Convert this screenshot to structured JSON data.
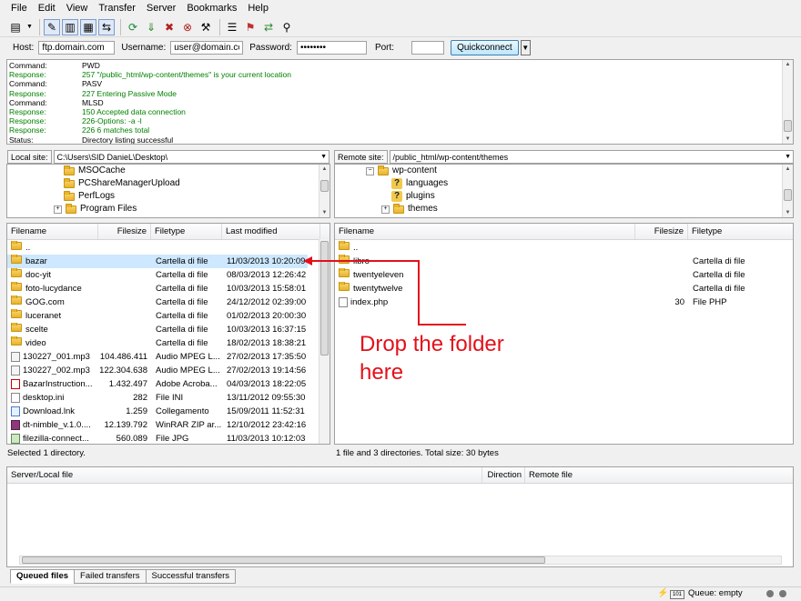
{
  "menu": [
    "File",
    "Edit",
    "View",
    "Transfer",
    "Server",
    "Bookmarks",
    "Help"
  ],
  "quickconnect": {
    "host_label": "Host:",
    "host_value": "ftp.domain.com",
    "username_label": "Username:",
    "username_value": "user@domain.com",
    "password_label": "Password:",
    "password_value": "••••••••",
    "port_label": "Port:",
    "port_value": "",
    "button_label": "Quickconnect"
  },
  "log": [
    {
      "k": "Command:",
      "v": "PWD",
      "type": "cmd"
    },
    {
      "k": "Response:",
      "v": "257 \"/public_html/wp-content/themes\" is your current location",
      "type": "resp"
    },
    {
      "k": "Command:",
      "v": "PASV",
      "type": "cmd"
    },
    {
      "k": "Response:",
      "v": "227 Entering Passive Mode",
      "type": "resp"
    },
    {
      "k": "Command:",
      "v": "MLSD",
      "type": "cmd"
    },
    {
      "k": "Response:",
      "v": "150 Accepted data connection",
      "type": "resp"
    },
    {
      "k": "Response:",
      "v": "226-Options: -a -l",
      "type": "resp"
    },
    {
      "k": "Response:",
      "v": "226 6 matches total",
      "type": "resp"
    },
    {
      "k": "Status:",
      "v": "Directory listing successful",
      "type": "stat"
    }
  ],
  "local": {
    "site_label": "Local site:",
    "path": "C:\\Users\\SID DanieL\\Desktop\\",
    "tree": [
      "MSOCache",
      "PCShareManagerUpload",
      "PerfLogs",
      "Program Files"
    ],
    "columns": [
      "Filename",
      "Filesize",
      "Filetype",
      "Last modified"
    ],
    "files": [
      {
        "name": "..",
        "size": "",
        "type": "",
        "date": "",
        "icon": "folder"
      },
      {
        "name": "bazar",
        "size": "",
        "type": "Cartella di file",
        "date": "11/03/2013 10:20:09",
        "icon": "folder"
      },
      {
        "name": "doc-yit",
        "size": "",
        "type": "Cartella di file",
        "date": "08/03/2013 12:26:42",
        "icon": "folder"
      },
      {
        "name": "foto-lucydance",
        "size": "",
        "type": "Cartella di file",
        "date": "10/03/2013 15:58:01",
        "icon": "folder"
      },
      {
        "name": "GOG.com",
        "size": "",
        "type": "Cartella di file",
        "date": "24/12/2012 02:39:00",
        "icon": "folder"
      },
      {
        "name": "luceranet",
        "size": "",
        "type": "Cartella di file",
        "date": "01/02/2013 20:00:30",
        "icon": "folder"
      },
      {
        "name": "scelte",
        "size": "",
        "type": "Cartella di file",
        "date": "10/03/2013 16:37:15",
        "icon": "folder"
      },
      {
        "name": "video",
        "size": "",
        "type": "Cartella di file",
        "date": "18/02/2013 18:38:21",
        "icon": "folder"
      },
      {
        "name": "130227_001.mp3",
        "size": "104.486.411",
        "type": "Audio MPEG L...",
        "date": "27/02/2013 17:35:50",
        "icon": "mp3"
      },
      {
        "name": "130227_002.mp3",
        "size": "122.304.638",
        "type": "Audio MPEG L...",
        "date": "27/02/2013 19:14:56",
        "icon": "mp3"
      },
      {
        "name": "BazarInstruction...",
        "size": "1.432.497",
        "type": "Adobe Acroba...",
        "date": "04/03/2013 18:22:05",
        "icon": "pdf"
      },
      {
        "name": "desktop.ini",
        "size": "282",
        "type": "File INI",
        "date": "13/11/2012 09:55:30",
        "icon": "file"
      },
      {
        "name": "Download.lnk",
        "size": "1.259",
        "type": "Collegamento",
        "date": "15/09/2011 11:52:31",
        "icon": "lnk"
      },
      {
        "name": "dt-nimble_v.1.0....",
        "size": "12.139.792",
        "type": "WinRAR ZIP ar...",
        "date": "12/10/2012 23:42:16",
        "icon": "rar"
      },
      {
        "name": "filezilla-connect...",
        "size": "560.089",
        "type": "File JPG",
        "date": "11/03/2013 10:12:03",
        "icon": "jpg"
      }
    ],
    "status": "Selected 1 directory."
  },
  "remote": {
    "site_label": "Remote site:",
    "path": "/public_html/wp-content/themes",
    "tree": [
      {
        "name": "wp-content",
        "icon": "folder"
      },
      {
        "name": "languages",
        "icon": "q"
      },
      {
        "name": "plugins",
        "icon": "q"
      },
      {
        "name": "themes",
        "icon": "folder"
      }
    ],
    "columns": [
      "Filename",
      "Filesize",
      "Filetype"
    ],
    "files": [
      {
        "name": "..",
        "size": "",
        "type": "",
        "icon": "folder"
      },
      {
        "name": "libro",
        "size": "",
        "type": "Cartella di file",
        "icon": "folder"
      },
      {
        "name": "twentyeleven",
        "size": "",
        "type": "Cartella di file",
        "icon": "folder"
      },
      {
        "name": "twentytwelve",
        "size": "",
        "type": "Cartella di file",
        "icon": "folder"
      },
      {
        "name": "index.php",
        "size": "30",
        "type": "File PHP",
        "icon": "file"
      }
    ],
    "status": "1 file and 3 directories. Total size: 30 bytes"
  },
  "queue": {
    "columns": [
      "Server/Local file",
      "Direction",
      "Remote file"
    ],
    "tabs": [
      "Queued files",
      "Failed transfers",
      "Successful transfers"
    ]
  },
  "statusbar": {
    "queue": "Queue: empty"
  },
  "annotation": {
    "text": "Drop the folder here",
    "color": "#e3101a"
  }
}
